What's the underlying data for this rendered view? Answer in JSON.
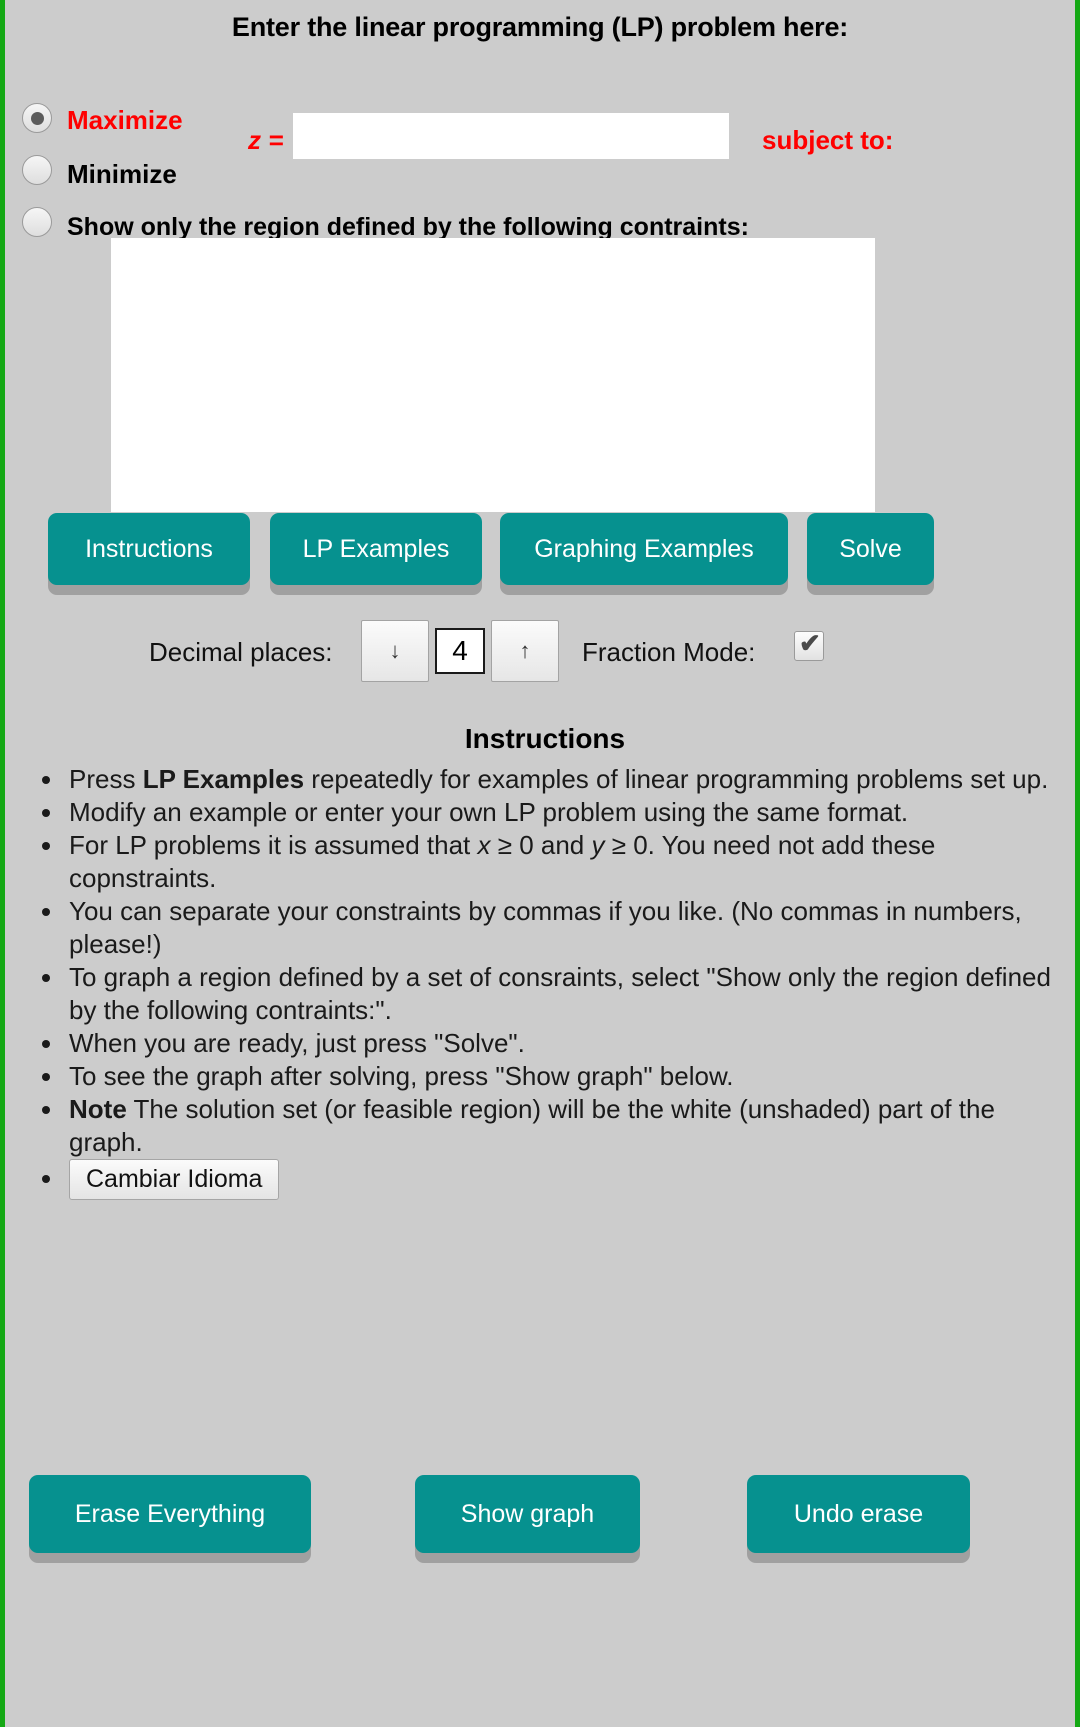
{
  "page": {
    "title": "Enter the linear programming (LP) problem here:",
    "border_color": "#14a814",
    "background": "#cccccc",
    "accent_color": "#06918f",
    "highlight_color": "#ff0000"
  },
  "objective": {
    "maximize_label": "Maximize",
    "minimize_label": "Minimize",
    "show_region_label": "Show only the region defined by the following contraints:",
    "selected": "maximize",
    "z_equals_label": "z =",
    "z_value": "",
    "z_placeholder": "",
    "subject_to_label": "subject to:"
  },
  "constraints": {
    "value": "",
    "placeholder": ""
  },
  "toolbar": {
    "instructions_label": "Instructions",
    "lp_examples_label": "LP Examples",
    "graphing_examples_label": "Graphing Examples",
    "solve_label": "Solve"
  },
  "settings": {
    "decimal_places_label": "Decimal places:",
    "decimal_decrease_label": "↓",
    "decimal_value": "4",
    "decimal_increase_label": "↑",
    "fraction_mode_label": "Fraction Mode:",
    "fraction_mode_checked": true,
    "fraction_mode_glyph": "✔"
  },
  "instructions": {
    "heading": "Instructions",
    "items": [
      {
        "parts": [
          {
            "text": "Press ",
            "style": "normal"
          },
          {
            "text": "LP Examples",
            "style": "bold"
          },
          {
            "text": " repeatedly for examples of linear programming problems set up.",
            "style": "normal"
          }
        ]
      },
      {
        "parts": [
          {
            "text": "Modify an example or enter your own LP problem using the same format.",
            "style": "normal"
          }
        ]
      },
      {
        "parts": [
          {
            "text": "For LP problems it is assumed that ",
            "style": "normal"
          },
          {
            "text": "x",
            "style": "italic"
          },
          {
            "text": " ≥ 0 and ",
            "style": "normal"
          },
          {
            "text": "y",
            "style": "italic"
          },
          {
            "text": " ≥ 0. You need not add these copnstraints.",
            "style": "normal"
          }
        ]
      },
      {
        "parts": [
          {
            "text": "You can separate your constraints by commas if you like. (No commas in numbers, please!)",
            "style": "normal"
          }
        ]
      },
      {
        "parts": [
          {
            "text": "To graph a region defined by a set of consraints, select \"Show only the region defined by the following contraints:\".",
            "style": "normal"
          }
        ]
      },
      {
        "parts": [
          {
            "text": "When you are ready, just press \"Solve\".",
            "style": "normal"
          }
        ]
      },
      {
        "parts": [
          {
            "text": "To see the graph after solving, press \"Show graph\" below.",
            "style": "normal"
          }
        ]
      },
      {
        "parts": [
          {
            "text": "Note",
            "style": "bold"
          },
          {
            "text": " The solution set (or feasible region) will be the white (unshaded) part of the graph.",
            "style": "normal"
          }
        ]
      }
    ],
    "language_button_label": "Cambiar Idioma"
  },
  "footer": {
    "erase_label": "Erase Everything",
    "show_graph_label": "Show graph",
    "undo_label": "Undo erase"
  }
}
